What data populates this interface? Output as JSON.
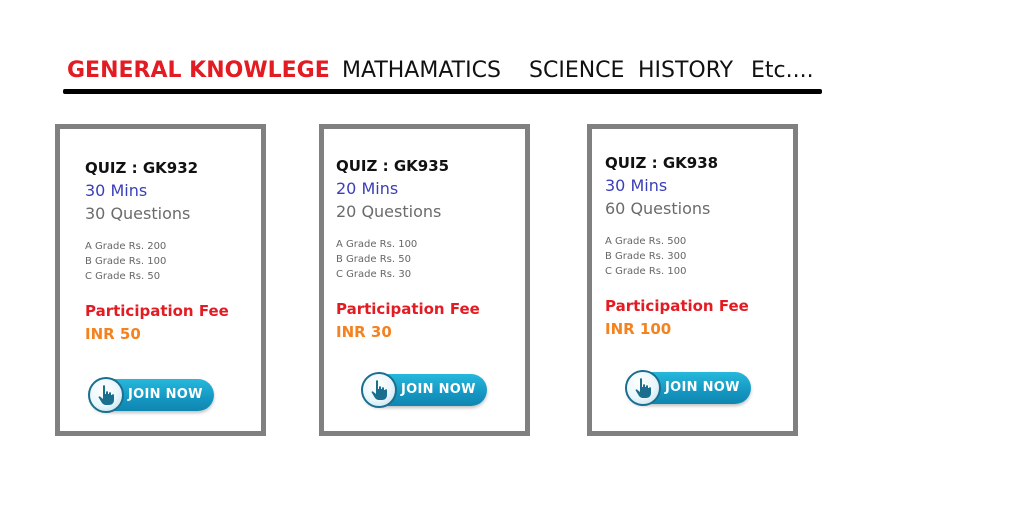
{
  "nav": {
    "tabs": [
      {
        "label": "GENERAL KNOWLEGE",
        "active": true
      },
      {
        "label": "MATHAMATICS"
      },
      {
        "label": "SCIENCE"
      },
      {
        "label": "HISTORY"
      },
      {
        "label": "Etc...."
      }
    ]
  },
  "colors": {
    "active_tab": "#e31b23",
    "duration_text": "#3a3fb8",
    "fee_label": "#e31b23",
    "fee_value": "#f58220",
    "card_border": "#808080",
    "button": "#1497c2"
  },
  "quizzes": [
    {
      "title": "QUIZ : GK932",
      "duration": "30 Mins",
      "questions": "30 Questions",
      "grades": [
        "A Grade Rs. 200",
        "B Grade Rs. 100",
        "C Grade Rs. 50"
      ],
      "fee_label": "Participation Fee",
      "fee": "INR 50",
      "join_label": "JOIN NOW",
      "join_icon": "pointing-hand-icon"
    },
    {
      "title": "QUIZ : GK935",
      "duration": "20 Mins",
      "questions": "20 Questions",
      "grades": [
        "A Grade Rs. 100",
        "B Grade Rs. 50",
        "C Grade Rs. 30"
      ],
      "fee_label": "Participation Fee",
      "fee": "INR 30",
      "join_label": "JOIN NOW",
      "join_icon": "pointing-hand-icon"
    },
    {
      "title": "QUIZ : GK938",
      "duration": "30 Mins",
      "questions": "60 Questions",
      "grades": [
        "A Grade Rs. 500",
        "B Grade Rs. 300",
        "C Grade Rs. 100"
      ],
      "fee_label": "Participation Fee",
      "fee": "INR 100",
      "join_label": "JOIN NOW",
      "join_icon": "pointing-hand-icon"
    }
  ]
}
